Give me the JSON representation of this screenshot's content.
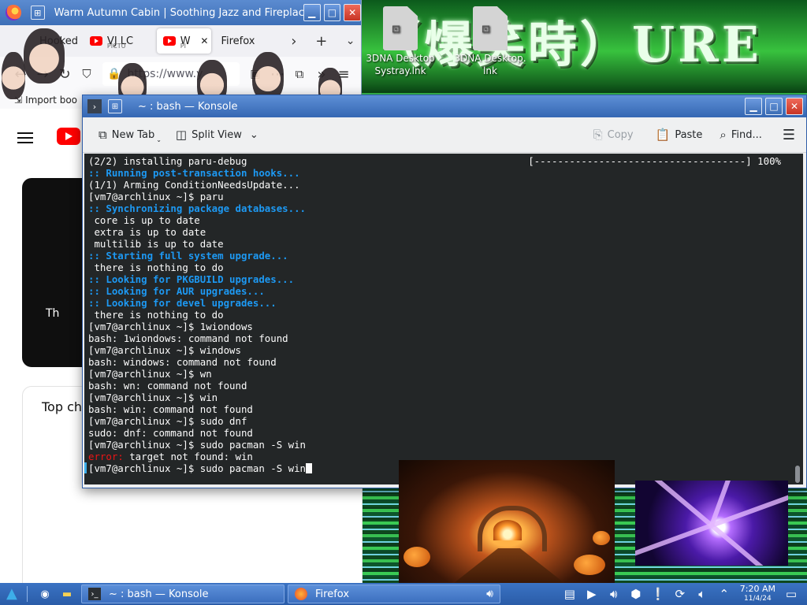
{
  "desktop": {
    "banner_text": "（爆笑時）URE",
    "icons": [
      {
        "name": "3DNA Desktop Systray.lnk",
        "label": "3DNA Desktop Systray.lnk",
        "glyph": "⊡"
      },
      {
        "name": "3DNA Desktop.lnk",
        "label": "3DNA Desktop. lnk",
        "glyph": "⊡"
      }
    ]
  },
  "firefox": {
    "window_title": "Warm Autumn Cabin | Soothing Jazz and Fireplac...",
    "tabs": [
      {
        "label": "Hooked",
        "sub": ""
      },
      {
        "label": "VJ LC",
        "sub": "PICTU"
      },
      {
        "label": "W",
        "sub": "PI"
      },
      {
        "label": "Firefox",
        "sub": ""
      }
    ],
    "url": "https://www.y",
    "bookmark": "Import boo",
    "page": {
      "player_caption": "Th",
      "card_title": "Top cha"
    }
  },
  "konsole": {
    "window_title": "~ : bash — Konsole",
    "toolbar": {
      "new_tab": "New Tab",
      "split_view": "Split View",
      "copy": "Copy",
      "paste": "Paste",
      "find": "Find..."
    },
    "progress_text": "[------------------------------------] 100%",
    "lines": [
      {
        "text": "(2/2) installing paru-debug",
        "style": "normal"
      },
      {
        "text": ":: Running post-transaction hooks...",
        "style": "blue"
      },
      {
        "text": "(1/1) Arming ConditionNeedsUpdate...",
        "style": "normal"
      },
      {
        "text": "[vm7@archlinux ~]$ paru",
        "style": "normal"
      },
      {
        "text": ":: Synchronizing package databases...",
        "style": "blue"
      },
      {
        "text": " core is up to date",
        "style": "normal"
      },
      {
        "text": " extra is up to date",
        "style": "normal"
      },
      {
        "text": " multilib is up to date",
        "style": "normal"
      },
      {
        "text": ":: Starting full system upgrade...",
        "style": "blue"
      },
      {
        "text": " there is nothing to do",
        "style": "normal"
      },
      {
        "text": ":: Looking for PKGBUILD upgrades...",
        "style": "blue"
      },
      {
        "text": ":: Looking for AUR upgrades...",
        "style": "blue"
      },
      {
        "text": ":: Looking for devel upgrades...",
        "style": "blue"
      },
      {
        "text": " there is nothing to do",
        "style": "normal"
      },
      {
        "text": "[vm7@archlinux ~]$ 1wiondows",
        "style": "normal"
      },
      {
        "text": "bash: 1wiondows: command not found",
        "style": "normal"
      },
      {
        "text": "[vm7@archlinux ~]$ windows",
        "style": "normal"
      },
      {
        "text": "bash: windows: command not found",
        "style": "normal"
      },
      {
        "text": "[vm7@archlinux ~]$ wn",
        "style": "normal"
      },
      {
        "text": "bash: wn: command not found",
        "style": "normal"
      },
      {
        "text": "[vm7@archlinux ~]$ win",
        "style": "normal"
      },
      {
        "text": "bash: win: command not found",
        "style": "normal"
      },
      {
        "text": "[vm7@archlinux ~]$ sudo dnf",
        "style": "normal"
      },
      {
        "text": "sudo: dnf: command not found",
        "style": "normal"
      },
      {
        "text": "[vm7@archlinux ~]$ sudo pacman -S win",
        "style": "normal"
      },
      {
        "text": " target not found: win",
        "style": "error",
        "prefix": "error:"
      },
      {
        "text": "[vm7@archlinux ~]$ sudo pacman -S win",
        "style": "cursor"
      }
    ]
  },
  "taskbar": {
    "tasks": [
      {
        "label": "~ : bash — Konsole",
        "icon": "terminal-icon"
      },
      {
        "label": "Firefox",
        "icon": "firefox-icon"
      }
    ],
    "time": "7:20 AM",
    "date": "11/4/24"
  },
  "colors": {
    "terminal_bg": "#232627",
    "terminal_blue": "#1d99f3",
    "terminal_error": "#ed1515",
    "titlebar_blue": "#3d6fb7"
  }
}
